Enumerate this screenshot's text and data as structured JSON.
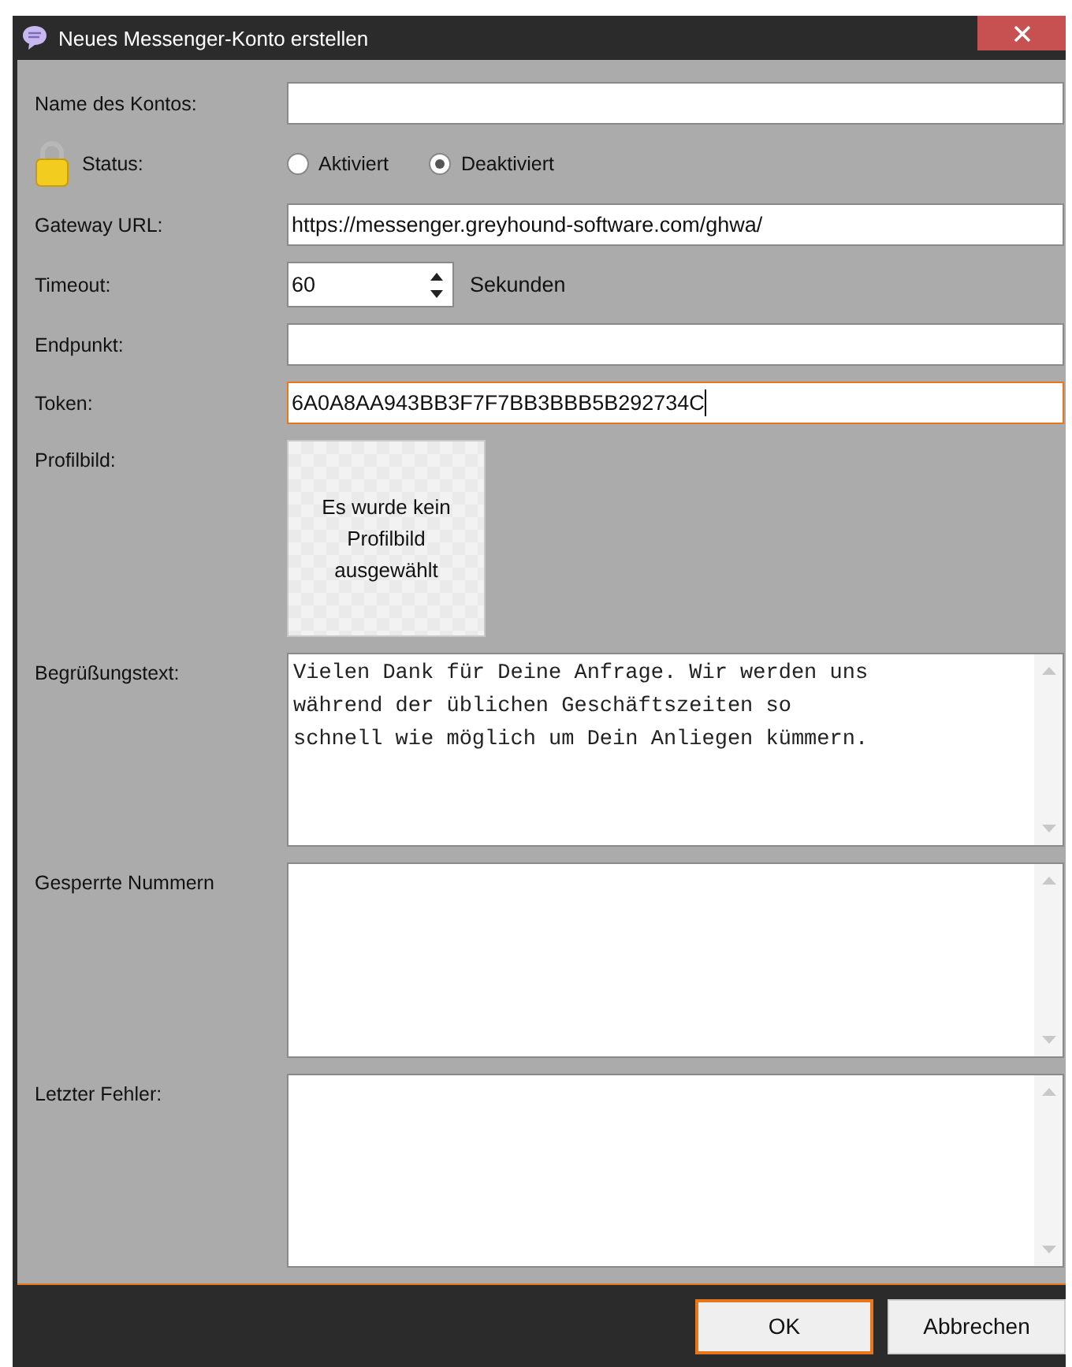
{
  "window": {
    "title": "Neues Messenger-Konto erstellen"
  },
  "fields": [
    {
      "kind": "text",
      "label": "Name des Kontos:",
      "focused": false
    },
    {
      "kind": "radio",
      "label": "Status:",
      "options": [
        {
          "label": "Aktiviert",
          "selected": false
        },
        {
          "label": "Deaktiviert",
          "selected": true
        }
      ]
    },
    {
      "kind": "text",
      "label": "Gateway URL:",
      "value": "https://messenger.greyhound-software.com/ghwa/",
      "focused": false
    },
    {
      "kind": "spin",
      "label": "Timeout:",
      "value": "60",
      "unit": "Sekunden"
    },
    {
      "kind": "text",
      "label": "Endpunkt:",
      "focused": false
    },
    {
      "kind": "text",
      "label": "Token:",
      "value": "6A0A8AA943BB3F7F7BB3BBB5B292734C",
      "focused": true
    },
    {
      "kind": "image",
      "label": "Profilbild:",
      "empty_text": "Es wurde kein Profilbild ausgewählt"
    },
    {
      "kind": "textarea",
      "label": "Begrüßungstext:",
      "value": "Vielen Dank für Deine Anfrage. Wir werden uns\nwährend der üblichen Geschäftszeiten so\nschnell wie möglich um Dein Anliegen kümmern."
    },
    {
      "kind": "textarea",
      "label": "Gesperrte Nummern"
    },
    {
      "kind": "textarea",
      "label": "Letzter Fehler:"
    }
  ],
  "buttons": [
    {
      "label": "OK",
      "default": true
    },
    {
      "label": "Abbrechen",
      "default": false
    }
  ]
}
